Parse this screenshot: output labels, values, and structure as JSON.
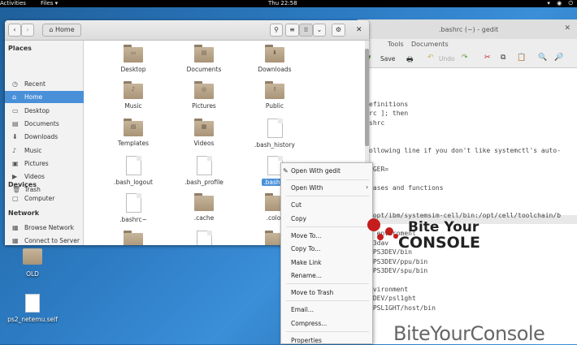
{
  "topbar": {
    "activities": "Activities",
    "files_menu": "Files ▾",
    "clock": "Thu 22:58",
    "tray": "▾ ◉ ⏻"
  },
  "gedit": {
    "title": ".bashrc (~) - gedit",
    "menu": [
      "rch",
      "Tools",
      "Documents"
    ],
    "toolbar": {
      "save": "Save",
      "undo": "Undo"
    },
    "code_lines": [
      "efinitions",
      "rc ]; then",
      "shrc",
      "",
      "",
      "ollowing line if you don't like systemctl's auto-",
      "",
      "AGER=",
      "",
      "iases and functions",
      "",
      "h",
      "/opt/ibm/systemsim-cell/bin:/opt/cell/toolchain/b",
      "",
      "n enviroment",
      "s3dav",
      "$PS3DEV/bin",
      "$PS3DEV/ppu/bin",
      "$PS3DEV/spu/bin",
      "",
      "nvironment",
      "3DEV/psl1ght",
      "$PSL1GHT/host/bin"
    ]
  },
  "files": {
    "location": "Home",
    "sidebar": {
      "places_header": "Places",
      "places": [
        {
          "label": "Recent",
          "icon": "clock-icon",
          "glyph": "◷"
        },
        {
          "label": "Home",
          "icon": "home-icon",
          "glyph": "⌂"
        },
        {
          "label": "Desktop",
          "icon": "desktop-icon",
          "glyph": "▭"
        },
        {
          "label": "Documents",
          "icon": "documents-icon",
          "glyph": "▤"
        },
        {
          "label": "Downloads",
          "icon": "download-icon",
          "glyph": "⬇"
        },
        {
          "label": "Music",
          "icon": "music-icon",
          "glyph": "♪"
        },
        {
          "label": "Pictures",
          "icon": "pictures-icon",
          "glyph": "▣"
        },
        {
          "label": "Videos",
          "icon": "videos-icon",
          "glyph": "▶"
        },
        {
          "label": "Trash",
          "icon": "trash-icon",
          "glyph": "🗑"
        }
      ],
      "devices_header": "Devices",
      "devices": [
        {
          "label": "Computer",
          "icon": "computer-icon",
          "glyph": "▢"
        }
      ],
      "network_header": "Network",
      "network": [
        {
          "label": "Browse Network",
          "icon": "network-icon",
          "glyph": "▦"
        },
        {
          "label": "Connect to Server",
          "icon": "server-icon",
          "glyph": "▦"
        }
      ]
    },
    "items": [
      {
        "name": "Desktop",
        "kind": "folder",
        "emblem": "▭"
      },
      {
        "name": "Documents",
        "kind": "folder",
        "emblem": "▤"
      },
      {
        "name": "Downloads",
        "kind": "folder",
        "emblem": "⬇"
      },
      {
        "name": "Music",
        "kind": "folder",
        "emblem": "♪"
      },
      {
        "name": "Pictures",
        "kind": "folder",
        "emblem": "◎"
      },
      {
        "name": "Public",
        "kind": "folder",
        "emblem": "⇧"
      },
      {
        "name": "Templates",
        "kind": "folder",
        "emblem": "▤"
      },
      {
        "name": "Videos",
        "kind": "folder",
        "emblem": "▦"
      },
      {
        "name": ".bash_history",
        "kind": "doc"
      },
      {
        "name": ".bash_logout",
        "kind": "doc"
      },
      {
        "name": ".bash_profile",
        "kind": "doc"
      },
      {
        "name": ".bashrc",
        "kind": "doc",
        "selected": true
      },
      {
        "name": ".bashrc~",
        "kind": "doc"
      },
      {
        "name": ".cache",
        "kind": "folder",
        "emblem": ""
      },
      {
        "name": ".color",
        "kind": "folder",
        "emblem": ""
      },
      {
        "name": "",
        "kind": "folder",
        "emblem": ""
      },
      {
        "name": "",
        "kind": "doc"
      },
      {
        "name": "",
        "kind": "folder",
        "emblem": ""
      }
    ]
  },
  "context_menu": {
    "open_with_gedit": "Open With gedit",
    "open_with": "Open With",
    "cut": "Cut",
    "copy": "Copy",
    "move_to": "Move To...",
    "copy_to": "Copy To...",
    "make_link": "Make Link",
    "rename": "Rename...",
    "move_to_trash": "Move to Trash",
    "email": "Email...",
    "compress": "Compress...",
    "properties": "Properties"
  },
  "desktop": {
    "icons": [
      "OLD",
      "ps2_netemu.self"
    ]
  },
  "watermark": {
    "logo_line1": "Bite Your",
    "logo_line2": "CONSOLE",
    "text": "BiteYourConsole"
  },
  "colors": {
    "accent": "#4a90d9",
    "desktop": "#2d7cc4"
  }
}
